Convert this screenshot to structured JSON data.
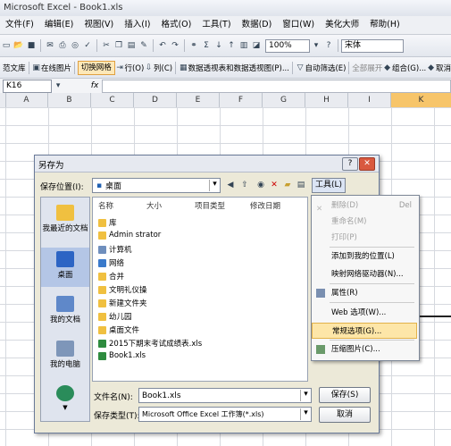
{
  "window_title": "Microsoft Excel - Book1.xls",
  "menu": [
    "文件(F)",
    "编辑(E)",
    "视图(V)",
    "插入(I)",
    "格式(O)",
    "工具(T)",
    "数据(D)",
    "窗口(W)",
    "美化大师",
    "帮助(H)"
  ],
  "toolbar1": {
    "zoom": "100%",
    "font": "宋体"
  },
  "toolbar2": {
    "items": [
      "范文库",
      "在线图片",
      "切换网格",
      "行(O)",
      "列(C)",
      "数据透视表和数据透视图(P)...",
      "自动筛选(E)",
      "全部展开",
      "组合(G)...",
      "取消"
    ]
  },
  "formula_bar": {
    "name_box": "K16",
    "fx": "fx"
  },
  "columns": [
    "A",
    "B",
    "C",
    "D",
    "E",
    "F",
    "G",
    "H",
    "I",
    "K"
  ],
  "dialog": {
    "title": "另存为",
    "save_in_label": "保存位置(I):",
    "save_in_value": "桌面",
    "tools_label": "工具(L)",
    "places": [
      "我最近的文档",
      "桌面",
      "我的文档",
      "我的电脑",
      ""
    ],
    "headers": [
      "名称",
      "大小",
      "项目类型",
      "修改日期"
    ],
    "files": [
      {
        "name": "库",
        "icon": "folder"
      },
      {
        "name": "Admin strator",
        "icon": "folder"
      },
      {
        "name": "计算机",
        "icon": "computer"
      },
      {
        "name": "网络",
        "icon": "network"
      },
      {
        "name": "合并",
        "icon": "folder"
      },
      {
        "name": "文明礼仪操",
        "icon": "folder"
      },
      {
        "name": "新建文件夹",
        "icon": "folder"
      },
      {
        "name": "幼儿园",
        "icon": "folder"
      },
      {
        "name": "桌面文件",
        "icon": "folder"
      },
      {
        "name": "2015下期末考试成绩表.xls",
        "icon": "excel"
      },
      {
        "name": "Book1.xls",
        "icon": "excel"
      }
    ],
    "filename_label": "文件名(N):",
    "filename_value": "Book1.xls",
    "filetype_label": "保存类型(T):",
    "filetype_value": "Microsoft Office Excel 工作簿(*.xls)",
    "save_button": "保存(S)",
    "cancel_button": "取消"
  },
  "tools_menu": [
    {
      "label": "删除(D)",
      "shortcut": "Del",
      "disabled": true
    },
    {
      "label": "重命名(M)",
      "shortcut": "",
      "disabled": true
    },
    {
      "label": "打印(P)",
      "shortcut": "",
      "disabled": true
    },
    {
      "label": "添加到我的位置(L)",
      "shortcut": "",
      "disabled": false
    },
    {
      "label": "映射网络驱动器(N)...",
      "shortcut": "",
      "disabled": false
    },
    {
      "label": "属性(R)",
      "shortcut": "",
      "disabled": false
    },
    {
      "label": "Web 选项(W)...",
      "shortcut": "",
      "disabled": false
    },
    {
      "label": "常规选项(G)...",
      "shortcut": "",
      "disabled": false,
      "highlighted": true
    },
    {
      "label": "压缩图片(C)...",
      "shortcut": "",
      "disabled": false
    }
  ]
}
